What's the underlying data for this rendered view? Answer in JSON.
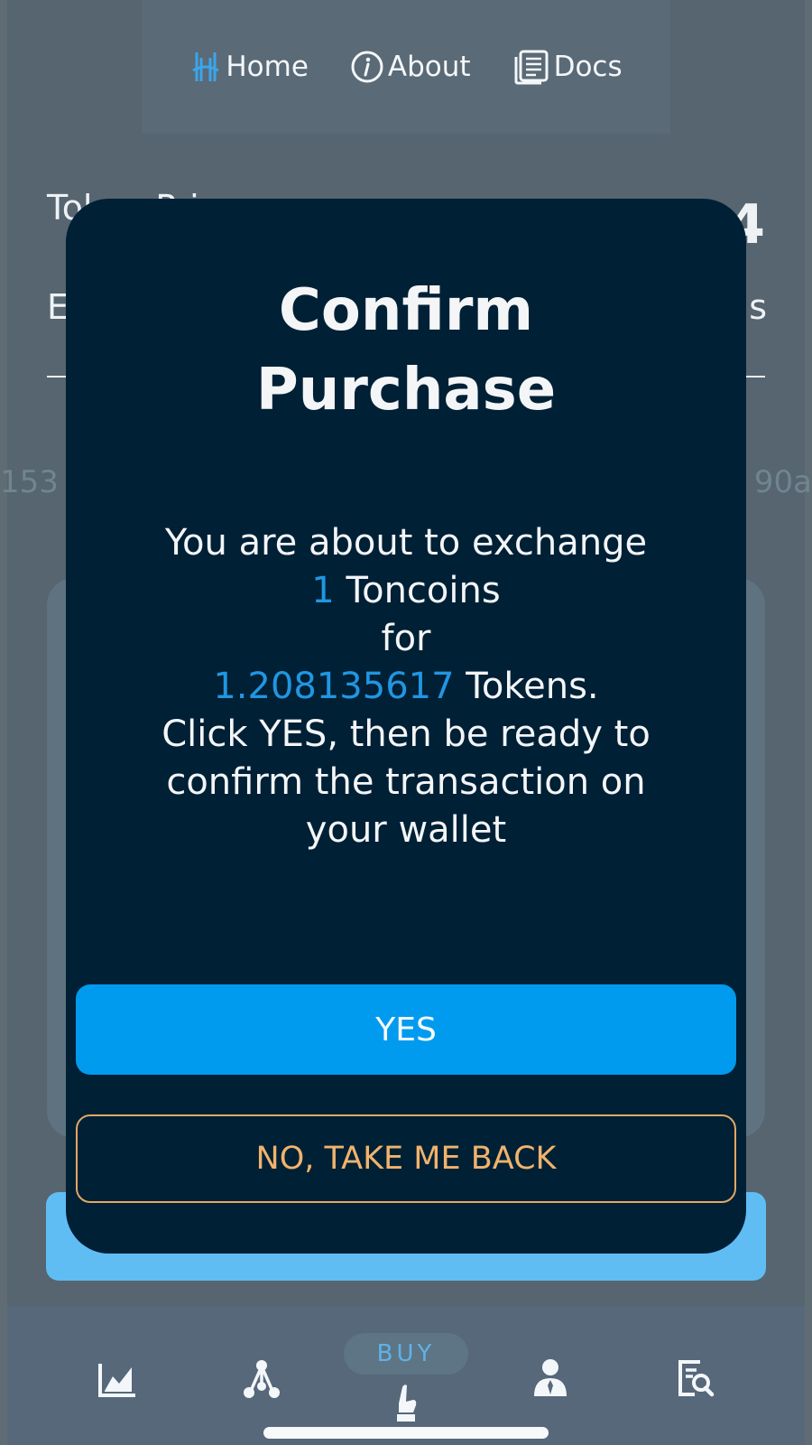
{
  "topnav": {
    "home_label": "Home",
    "about_label": "About",
    "docs_label": "Docs"
  },
  "background": {
    "row1_left": "Token Price",
    "row1_right": "4",
    "row2_left": "E",
    "row2_right": "s",
    "hash_left": "153",
    "hash_right": "90a"
  },
  "modal": {
    "title_line1": "Confirm",
    "title_line2": "Purchase",
    "line1": "You are about to exchange",
    "amount_in": "1",
    "currency_in": " Toncoins",
    "line_for": "for",
    "amount_out": "1.208135617",
    "currency_out": " Tokens.",
    "line5": "Click YES, then be ready to",
    "line6": "confirm the transaction on",
    "line7": "your wallet",
    "yes_label": "YES",
    "no_label": "NO, TAKE ME BACK"
  },
  "bottom_nav": {
    "buy_label": "BUY",
    "items": [
      "chart-icon",
      "network-icon",
      "buy-hand-icon",
      "user-icon",
      "report-search-icon"
    ]
  },
  "colors": {
    "modal_bg": "#002035",
    "accent": "#009bef",
    "highlight": "#2196e2",
    "secondary_border": "#e2a864"
  }
}
